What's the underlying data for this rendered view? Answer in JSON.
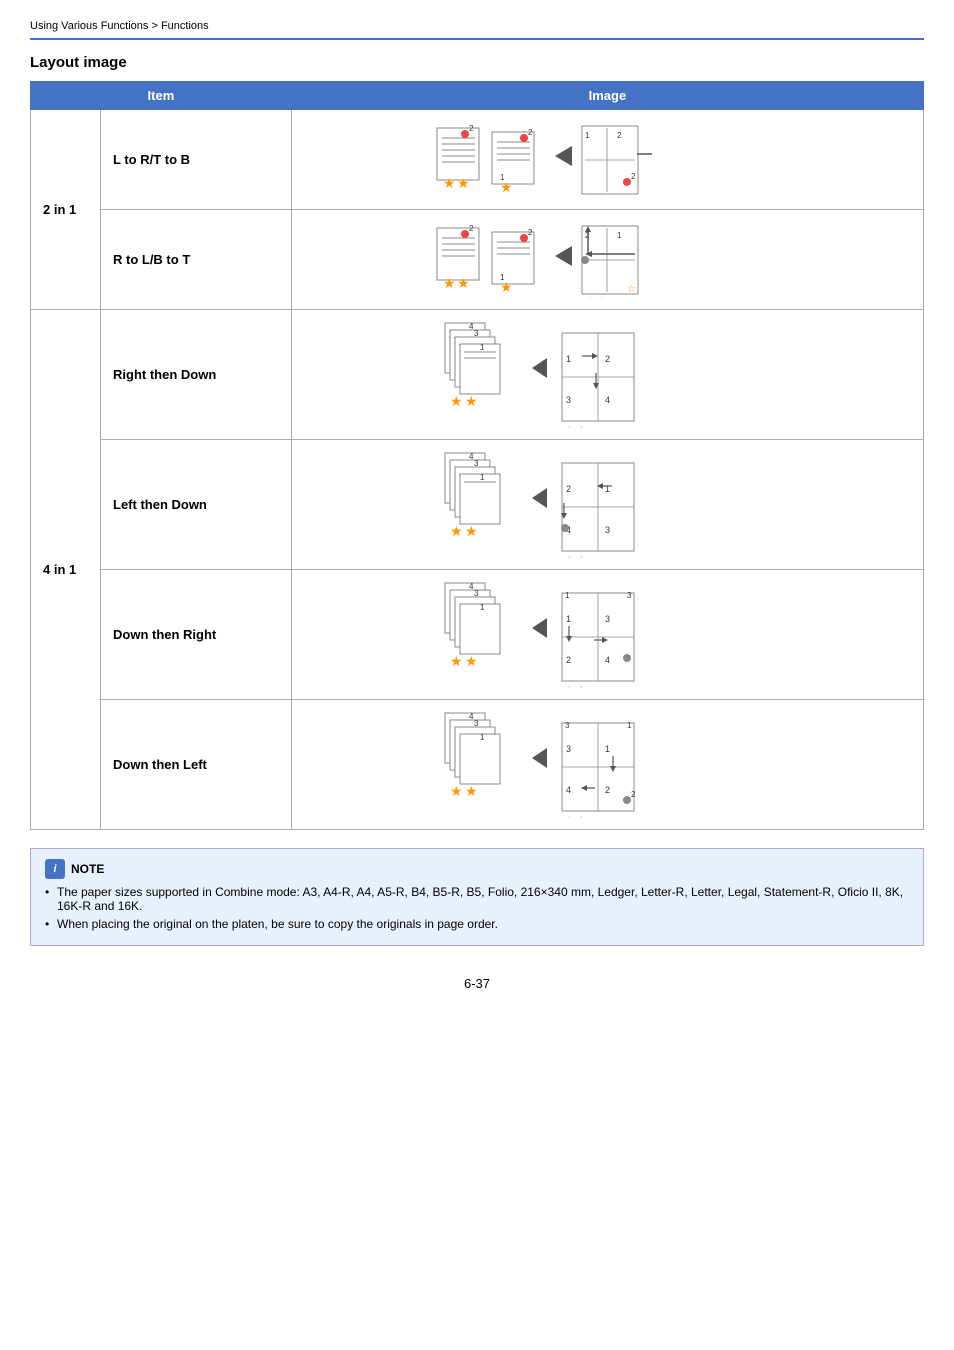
{
  "breadcrumb": {
    "text": "Using Various Functions > Functions"
  },
  "section": {
    "title": "Layout image"
  },
  "table": {
    "headers": [
      "Item",
      "Image"
    ],
    "groups": [
      {
        "group_label": "2 in 1",
        "rows": [
          {
            "label": "L to R/T to B"
          },
          {
            "label": "R to L/B to T"
          }
        ]
      },
      {
        "group_label": "4 in 1",
        "rows": [
          {
            "label": "Right then Down"
          },
          {
            "label": "Left then Down"
          },
          {
            "label": "Down then Right"
          },
          {
            "label": "Down then Left"
          }
        ]
      }
    ]
  },
  "note": {
    "title": "NOTE",
    "items": [
      "The paper sizes supported in Combine mode: A3, A4-R, A4, A5-R, B4, B5-R, B5, Folio, 216×340 mm, Ledger, Letter-R, Letter, Legal, Statement-R, Oficio II, 8K, 16K-R and 16K.",
      "When placing the original on the platen, be sure to copy the originals in page order."
    ]
  },
  "page_number": "6-37"
}
